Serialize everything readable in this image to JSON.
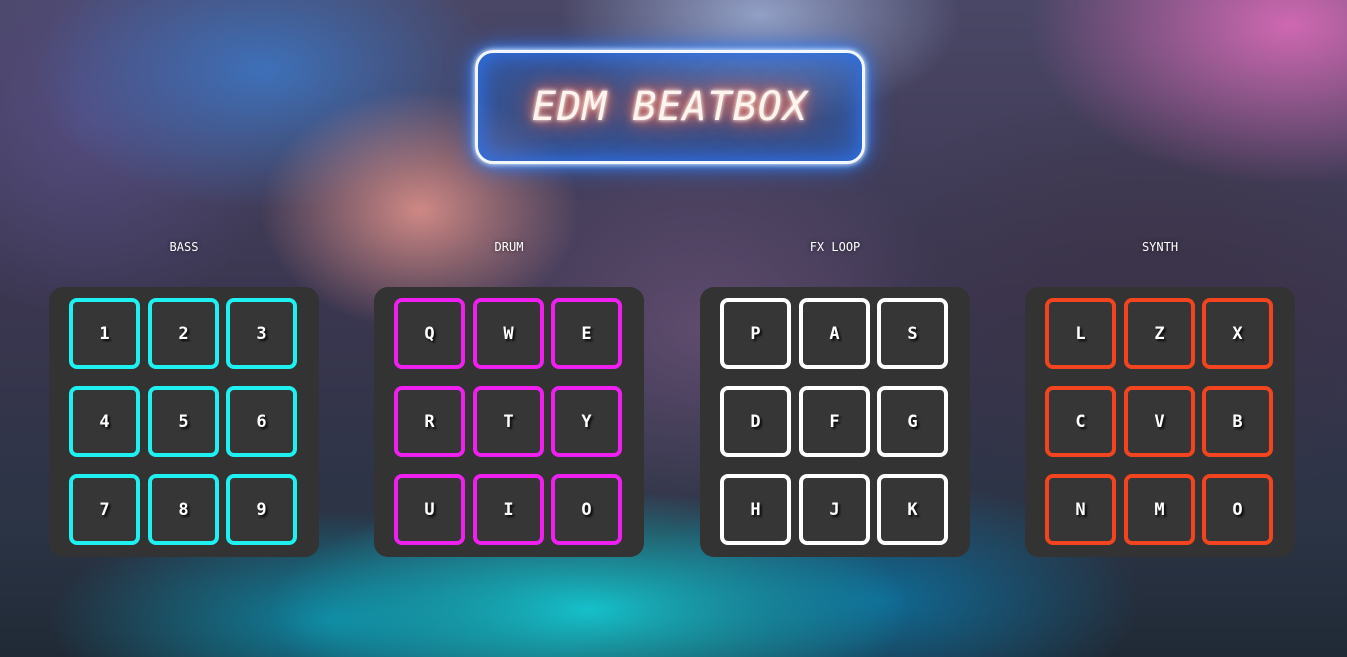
{
  "title": "EDM BEATBOX",
  "colors": {
    "bass": "#1ff0f0",
    "drum": "#ef1ff0",
    "fx_loop": "#ffffff",
    "synth": "#f2451f",
    "panel": "#333333"
  },
  "groups": [
    {
      "label": "BASS",
      "keys": [
        "1",
        "2",
        "3",
        "4",
        "5",
        "6",
        "7",
        "8",
        "9"
      ]
    },
    {
      "label": "DRUM",
      "keys": [
        "Q",
        "W",
        "E",
        "R",
        "T",
        "Y",
        "U",
        "I",
        "O"
      ]
    },
    {
      "label": "FX LOOP",
      "keys": [
        "P",
        "A",
        "S",
        "D",
        "F",
        "G",
        "H",
        "J",
        "K"
      ]
    },
    {
      "label": "SYNTH",
      "keys": [
        "L",
        "Z",
        "X",
        "C",
        "V",
        "B",
        "N",
        "M",
        "O"
      ]
    }
  ]
}
